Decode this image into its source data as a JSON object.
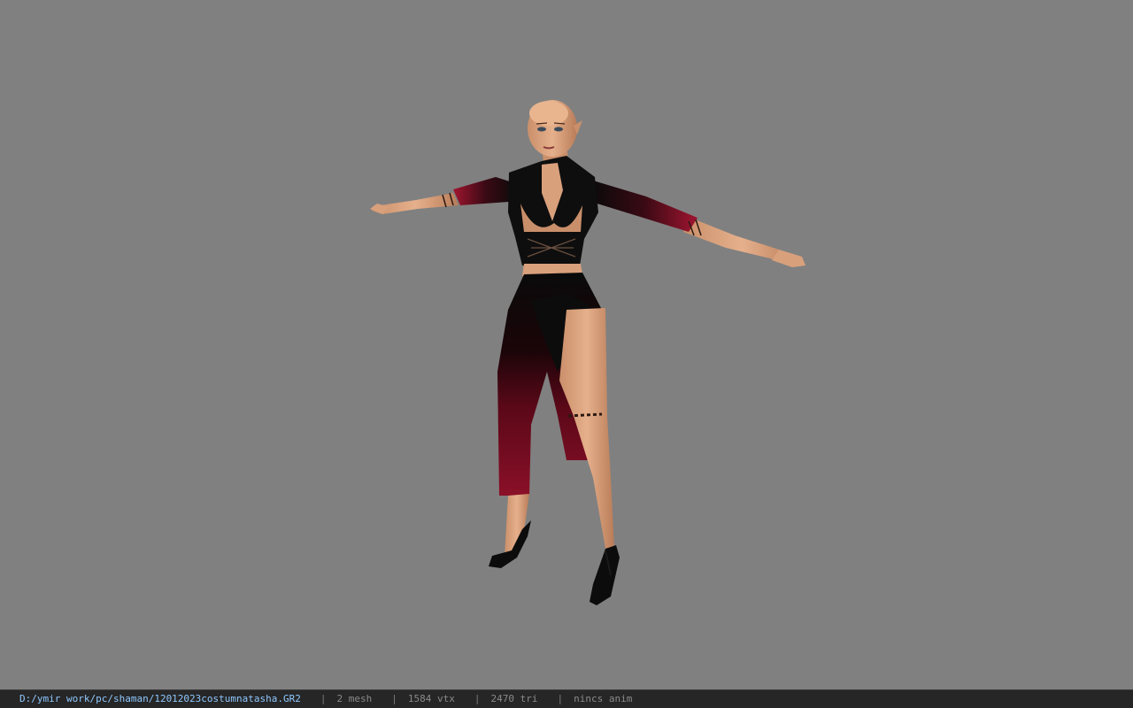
{
  "viewport": {
    "background_color": "#808080",
    "model": "character-model"
  },
  "status_bar": {
    "file_path": "D:/ymir work/pc/shaman/12012023costumnatasha.GR2",
    "separator": "|",
    "mesh_count": "2 mesh",
    "vertex_count": "1584 vtx",
    "triangle_count": "2470 tri",
    "anim_status": "nincs anim"
  },
  "colors": {
    "status_bg": "#262626",
    "path_text": "#8fc8ff",
    "stat_text": "#8a8a8a"
  }
}
